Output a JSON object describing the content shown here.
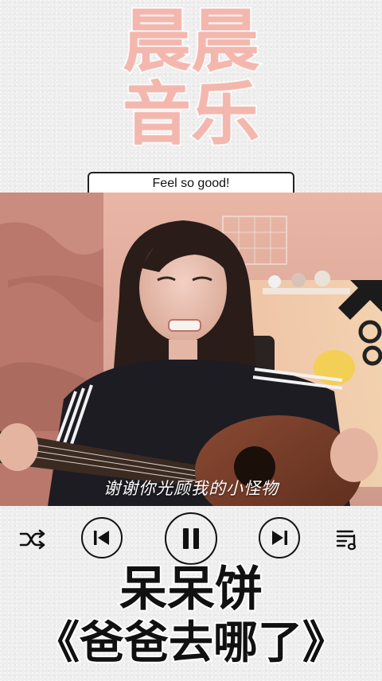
{
  "header": {
    "channel_line1": "晨晨",
    "channel_line2": "音乐"
  },
  "song_caption": "Feel so good!",
  "video": {
    "subtitle": "谢谢你光顾我的小怪物"
  },
  "controls": {
    "shuffle_icon": "shuffle-icon",
    "previous_icon": "skip-previous-icon",
    "pause_icon": "pause-icon",
    "next_icon": "skip-next-icon",
    "playlist_icon": "playlist-icon"
  },
  "footer": {
    "artist": "呆呆饼",
    "song_title": "《爸爸去哪了》"
  },
  "colors": {
    "title_pink": "#f4b7ad",
    "caption_text": "#111111",
    "background": "#eeeeee"
  }
}
